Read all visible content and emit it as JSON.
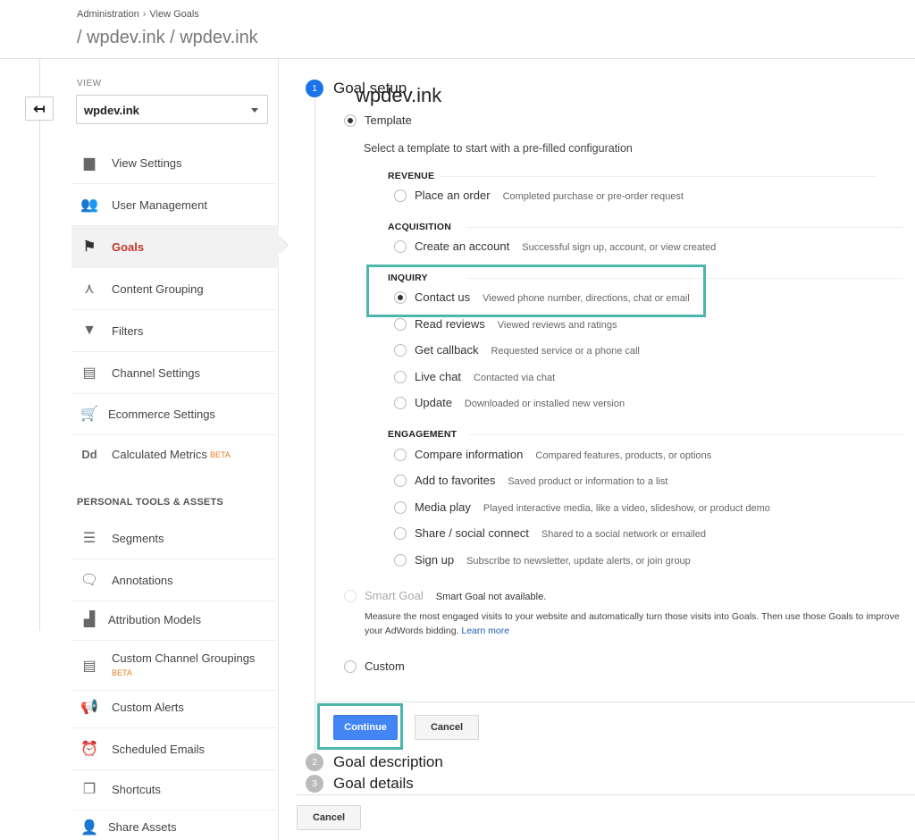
{
  "header": {
    "breadcrumb": [
      "Administration",
      "View Goals"
    ],
    "breadcrumb_sep": "›",
    "title": "wpdev.ink",
    "subtitle": " / wpdev.ink / wpdev.ink"
  },
  "back_icon": "↤",
  "sidebar": {
    "view_label": "VIEW",
    "view_value": "wpdev.ink",
    "items": [
      {
        "label": "View Settings",
        "icon": "document-icon",
        "glyph": "▆"
      },
      {
        "label": "User Management",
        "icon": "users-icon",
        "glyph": "👥"
      },
      {
        "label": "Goals",
        "icon": "flag-icon",
        "glyph": "⚑"
      },
      {
        "label": "Content Grouping",
        "icon": "grouping-icon",
        "glyph": "⋏"
      },
      {
        "label": "Filters",
        "icon": "filter-icon",
        "glyph": "▼"
      },
      {
        "label": "Channel Settings",
        "icon": "channel-icon",
        "glyph": "▤"
      },
      {
        "label": "Ecommerce Settings",
        "icon": "cart-icon",
        "glyph": "🛒"
      },
      {
        "label": "Calculated Metrics",
        "badge": "BETA",
        "icon": "dd-icon",
        "glyph": "Dd"
      }
    ],
    "section_title": "PERSONAL TOOLS & ASSETS",
    "tools": [
      {
        "label": "Segments",
        "icon": "segments-icon",
        "glyph": "☰"
      },
      {
        "label": "Annotations",
        "icon": "annotation-icon",
        "glyph": "🗨"
      },
      {
        "label": "Attribution Models",
        "icon": "bar-chart-icon",
        "glyph": "▟"
      },
      {
        "label": "Custom Channel Groupings",
        "badge": "BETA",
        "icon": "channel-icon",
        "glyph": "▤"
      },
      {
        "label": "Custom Alerts",
        "icon": "megaphone-icon",
        "glyph": "📢"
      },
      {
        "label": "Scheduled Emails",
        "icon": "clock-icon",
        "glyph": "⏰"
      },
      {
        "label": "Shortcuts",
        "icon": "shortcut-icon",
        "glyph": "❐"
      },
      {
        "label": "Share Assets",
        "icon": "add-user-icon",
        "glyph": "👤"
      }
    ]
  },
  "goal_setup": {
    "step1": {
      "num": "1",
      "title": "Goal setup"
    },
    "template_label": "Template",
    "template_desc": "Select a template to start with a pre-filled configuration",
    "categories": {
      "revenue": {
        "title": "REVENUE",
        "options": [
          {
            "label": "Place an order",
            "desc": "Completed purchase or pre-order request"
          }
        ]
      },
      "acquisition": {
        "title": "ACQUISITION",
        "options": [
          {
            "label": "Create an account",
            "desc": "Successful sign up, account, or view created"
          }
        ]
      },
      "inquiry": {
        "title": "INQUIRY",
        "options": [
          {
            "label": "Contact us",
            "desc": "Viewed phone number, directions, chat or email"
          },
          {
            "label": "Read reviews",
            "desc": "Viewed reviews and ratings"
          },
          {
            "label": "Get callback",
            "desc": "Requested service or a phone call"
          },
          {
            "label": "Live chat",
            "desc": "Contacted via chat"
          },
          {
            "label": "Update",
            "desc": "Downloaded or installed new version"
          }
        ]
      },
      "engagement": {
        "title": "ENGAGEMENT",
        "options": [
          {
            "label": "Compare information",
            "desc": "Compared features, products, or options"
          },
          {
            "label": "Add to favorites",
            "desc": "Saved product or information to a list"
          },
          {
            "label": "Media play",
            "desc": "Played interactive media, like a video, slideshow, or product demo"
          },
          {
            "label": "Share / social connect",
            "desc": "Shared to a social network or emailed"
          },
          {
            "label": "Sign up",
            "desc": "Subscribe to newsletter, update alerts, or join group"
          }
        ]
      }
    },
    "smart_goal": {
      "label": "Smart Goal",
      "status": "Smart Goal not available.",
      "desc": "Measure the most engaged visits to your website and automatically turn those visits into Goals. Then use those Goals to improve your AdWords bidding.",
      "link": "Learn more"
    },
    "custom_label": "Custom",
    "continue_label": "Continue",
    "cancel_label": "Cancel",
    "step2": {
      "num": "2",
      "title": "Goal description"
    },
    "step3": {
      "num": "3",
      "title": "Goal details"
    },
    "bottom_cancel_label": "Cancel"
  },
  "colors": {
    "accent": "#4285f4",
    "highlight": "#4db6ac",
    "active_nav": "#c0392b",
    "beta": "#e67e22"
  }
}
